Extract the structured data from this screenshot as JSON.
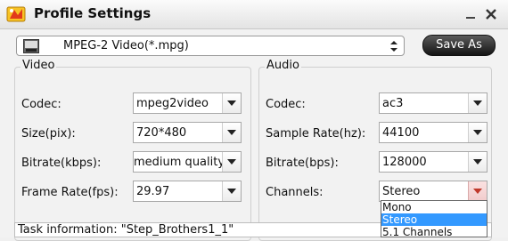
{
  "window": {
    "title": "Profile Settings"
  },
  "format": {
    "value": "MPEG-2 Video(*.mpg)",
    "save_label": "Save As"
  },
  "video": {
    "title": "Video",
    "codec_label": "Codec:",
    "codec_value": "mpeg2video",
    "size_label": "Size(pix):",
    "size_value": "720*480",
    "bitrate_label": "Bitrate(kbps):",
    "bitrate_value": "medium quality",
    "framerate_label": "Frame Rate(fps):",
    "framerate_value": "29.97"
  },
  "audio": {
    "title": "Audio",
    "codec_label": "Codec:",
    "codec_value": "ac3",
    "samplerate_label": "Sample Rate(hz):",
    "samplerate_value": "44100",
    "bitrate_label": "Bitrate(bps):",
    "bitrate_value": "128000",
    "channels_label": "Channels:",
    "channels_value": "Stereo",
    "channels_options": [
      "Mono",
      "Stereo",
      "5.1 Channels"
    ],
    "channels_selected": "Stereo"
  },
  "task": {
    "text": "Task information: \"Step_Brothers1_1\""
  },
  "colors": {
    "selection": "#3399ff",
    "save_button": "#1a1a1a"
  },
  "icons": {
    "app": "app-logo-icon",
    "format": "mpg-file-icon",
    "minimize": "minimize-icon",
    "close": "close-icon",
    "dropdown": "chevron-down-icon",
    "spin": "up-down-arrows-icon"
  }
}
